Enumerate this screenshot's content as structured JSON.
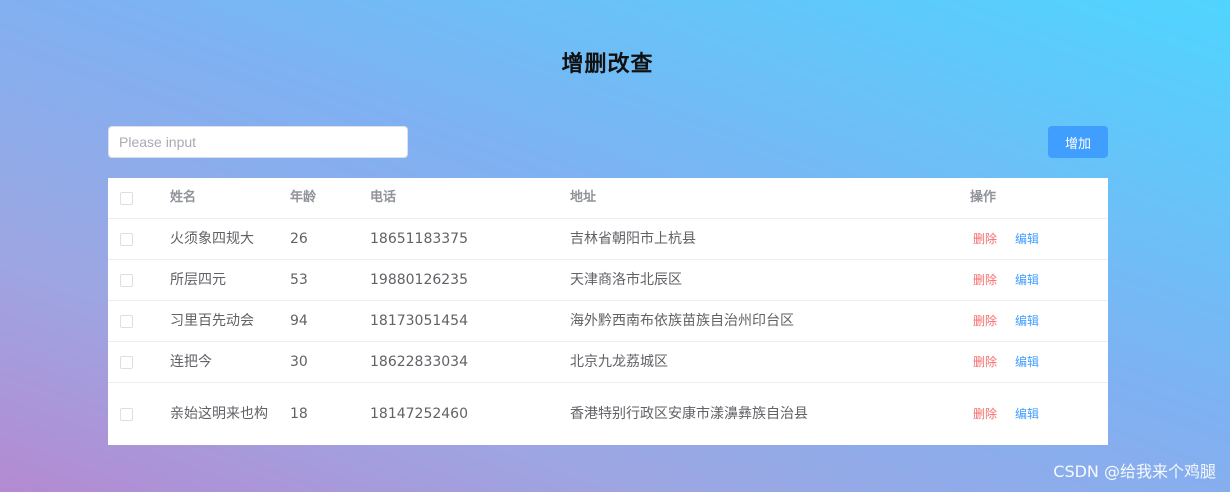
{
  "page": {
    "title": "增删改查"
  },
  "search": {
    "placeholder": "Please input"
  },
  "toolbar": {
    "add_label": "增加"
  },
  "table": {
    "headers": {
      "name": "姓名",
      "age": "年龄",
      "phone": "电话",
      "address": "地址",
      "ops": "操作"
    },
    "rows": [
      {
        "name": "火须象四规大",
        "age": "26",
        "phone": "18651183375",
        "address": "吉林省朝阳市上杭县"
      },
      {
        "name": "所层四元",
        "age": "53",
        "phone": "19880126235",
        "address": "天津商洛市北辰区"
      },
      {
        "name": "习里百先动会",
        "age": "94",
        "phone": "18173051454",
        "address": "海外黔西南布依族苗族自治州印台区"
      },
      {
        "name": "连把今",
        "age": "30",
        "phone": "18622833034",
        "address": "北京九龙荔城区"
      },
      {
        "name": "亲始这明来也构",
        "age": "18",
        "phone": "18147252460",
        "address": "香港特别行政区安康市漾濞彝族自治县"
      }
    ],
    "delete_label": "删除",
    "edit_label": "编辑"
  },
  "watermark": "CSDN @给我来个鸡腿",
  "colors": {
    "primary": "#409eff",
    "danger": "#f56c6c"
  }
}
